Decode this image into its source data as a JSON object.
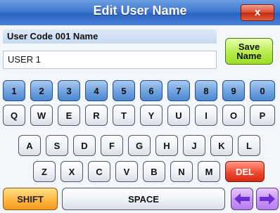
{
  "window": {
    "title": "Edit User Name",
    "close_label": "x"
  },
  "form": {
    "label": "User Code 001 Name",
    "name_value": "USER 1",
    "save_line1": "Save",
    "save_line2": "Name"
  },
  "keyboard": {
    "num_row": [
      "1",
      "2",
      "3",
      "4",
      "5",
      "6",
      "7",
      "8",
      "9",
      "0"
    ],
    "row_q": [
      "Q",
      "W",
      "E",
      "R",
      "T",
      "Y",
      "U",
      "I",
      "O",
      "P"
    ],
    "row_a": [
      "A",
      "S",
      "D",
      "F",
      "G",
      "H",
      "J",
      "K",
      "L"
    ],
    "row_z": [
      "Z",
      "X",
      "C",
      "V",
      "B",
      "N",
      "M"
    ],
    "del_label": "DEL",
    "shift_label": "SHIFT",
    "space_label": "SPACE",
    "left_icon": "arrow-left-icon",
    "right_icon": "arrow-right-icon"
  },
  "colors": {
    "title_bar": "#3f78d4",
    "save_button": "#b6ec4a",
    "del_key": "#f04a30",
    "shift_key": "#ffb640",
    "arrow_key": "#c896f6",
    "number_key": "#6fa1de"
  }
}
